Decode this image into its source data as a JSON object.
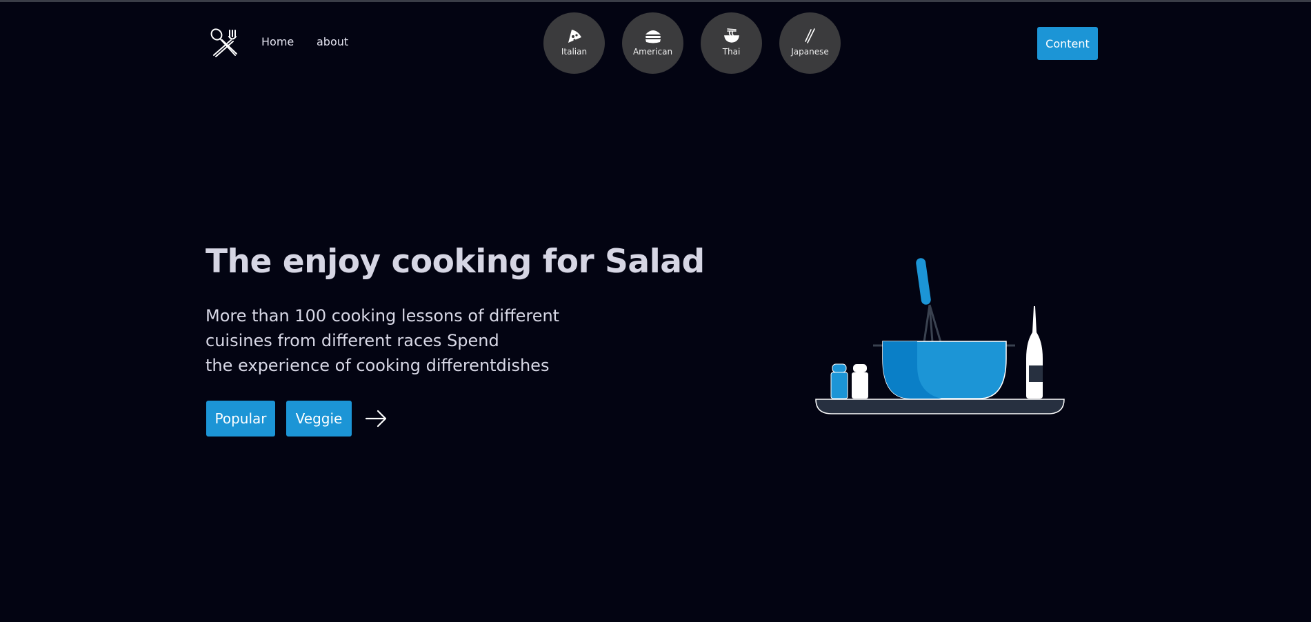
{
  "nav": {
    "logo_icon": "utensils-crossed-icon",
    "links": [
      {
        "label": "Home"
      },
      {
        "label": "about"
      }
    ],
    "cuisines": [
      {
        "label": "Italian",
        "icon": "pizza-icon"
      },
      {
        "label": "American",
        "icon": "burger-icon"
      },
      {
        "label": "Thai",
        "icon": "noodle-bowl-icon"
      },
      {
        "label": "Japanese",
        "icon": "chopsticks-icon"
      }
    ],
    "cta_label": "Content"
  },
  "hero": {
    "title": "The enjoy cooking for Salad",
    "description_lines": [
      "More than 100 cooking lessons of different",
      "cuisines from different races Spend",
      "the experience of cooking differentdishes"
    ],
    "buttons": [
      {
        "label": "Popular"
      },
      {
        "label": "Veggie"
      }
    ],
    "next_icon": "arrow-right-icon",
    "illustration": "mixing-bowl-illustration"
  },
  "colors": {
    "background": "#030412",
    "accent": "#1c95d6",
    "cuisine_circle": "#3b3b3d",
    "text": "#d8d8e6"
  }
}
